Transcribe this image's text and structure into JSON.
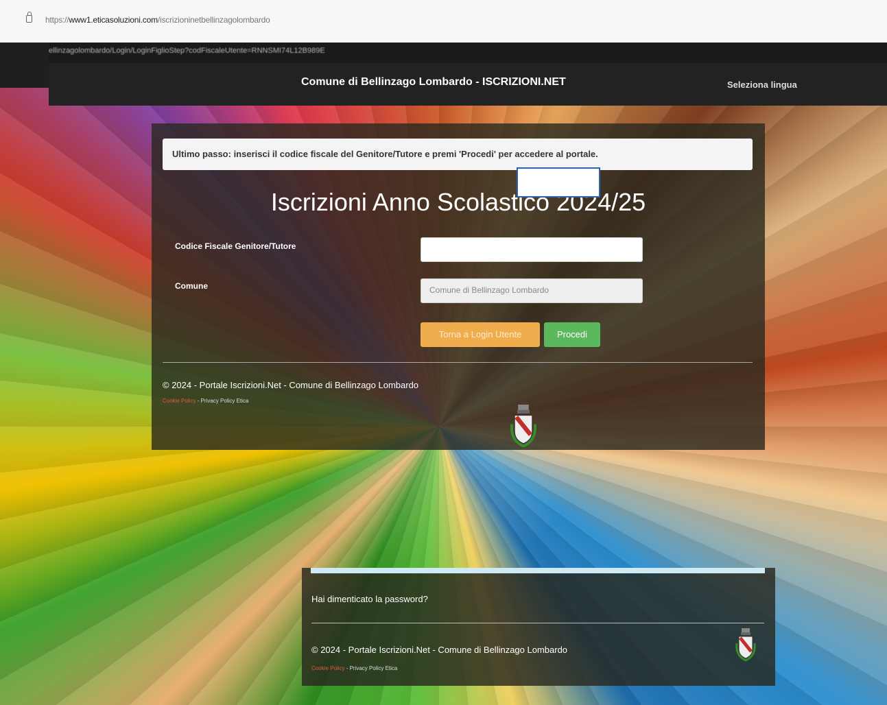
{
  "browser": {
    "url_prefix": "https://",
    "url_host": "www1.eticasoluzioni.com",
    "url_path": "/iscrizioninetbellinzagolombardo"
  },
  "overlay": {
    "partial_url": "ellinzagolombardo/Login/LoginFiglioStep?codFiscaleUtente=RNNSMI74L12B989E",
    "navbar": {
      "title": "Comune di Bellinzago Lombardo - ISCRIZIONI.NET",
      "language": "Seleziona lingua"
    },
    "alert": "Ultimo passo: inserisci il codice fiscale del Genitore/Tutore e premi 'Procedi' per accedere al portale.",
    "heading": "Iscrizioni Anno Scolastico 2024/25",
    "form": {
      "cf_label": "Codice Fiscale Genitore/Tutore",
      "cf_value": "",
      "comune_label": "Comune",
      "comune_placeholder": "Comune di Bellinzago Lombardo"
    },
    "buttons": {
      "back": "Torna a Login Utente",
      "proceed": "Procedi"
    },
    "footer": {
      "copyright": "© 2024 - Portale Iscrizioni.Net - Comune di Bellinzago Lombardo",
      "cookie_policy": "Cookie Policy",
      "separator": " - ",
      "privacy_policy": "Privacy Policy Etica"
    }
  },
  "bottom_panel": {
    "forgot": "Hai dimenticato la password?",
    "copyright": "© 2024 - Portale Iscrizioni.Net - Comune di Bellinzago Lombardo",
    "cookie_policy": "Cookie Policy",
    "separator": " - ",
    "privacy_policy": "Privacy Policy Etica"
  },
  "colors": {
    "navbar": "#222222",
    "btn_back": "#f0ad4e",
    "btn_proceed": "#5cb85c",
    "focus_border": "#2f5fb0"
  }
}
